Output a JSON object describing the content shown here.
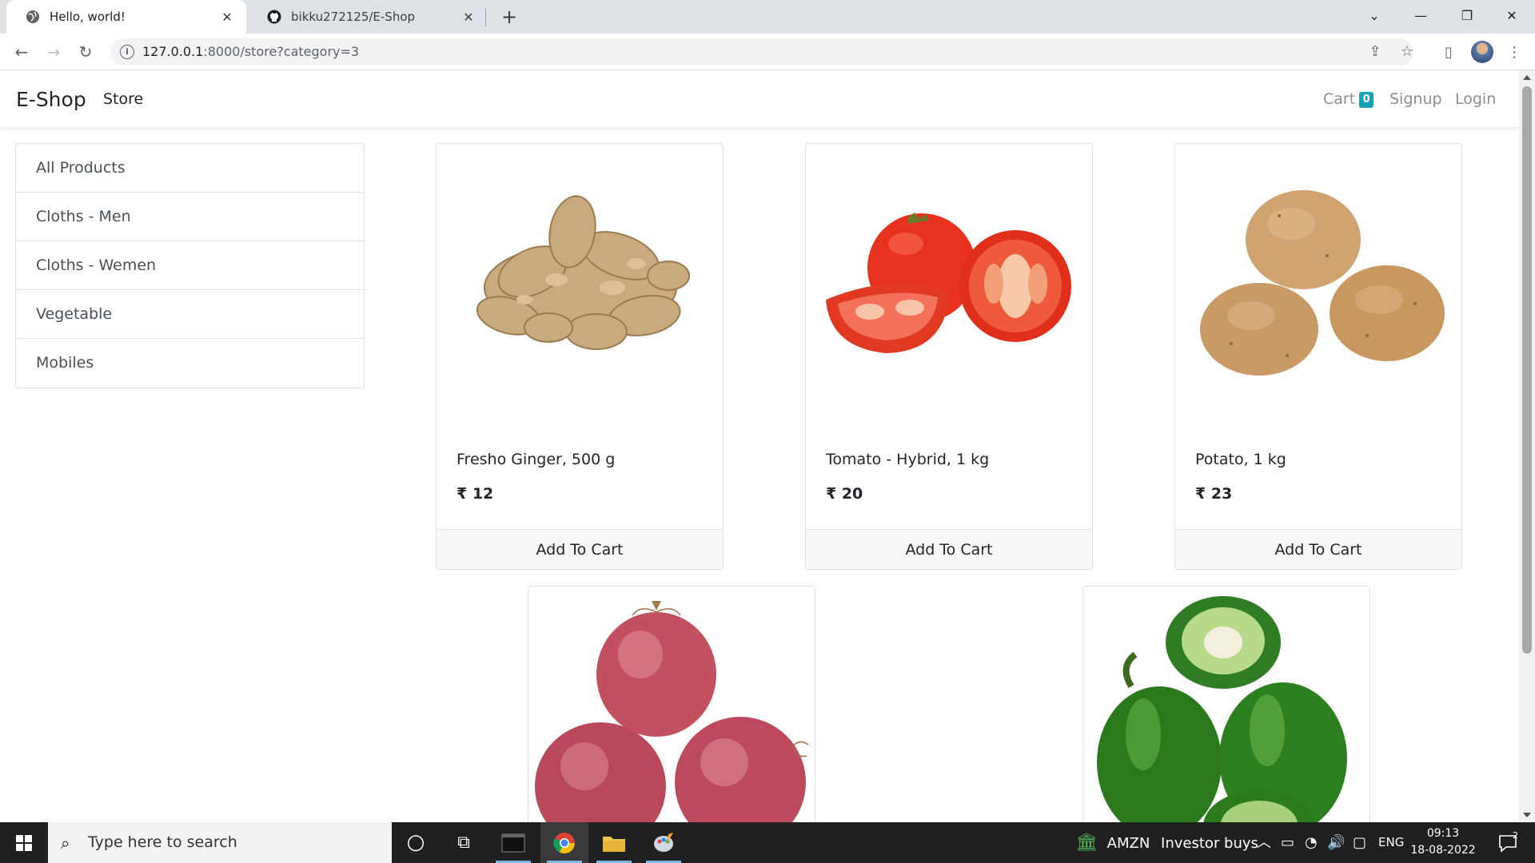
{
  "browser": {
    "tabs": [
      {
        "title": "Hello, world!"
      },
      {
        "title": "bikku272125/E-Shop"
      }
    ],
    "url_host": "127.0.0.1",
    "url_rest": ":8000/store?category=3"
  },
  "navbar": {
    "brand": "E-Shop",
    "store": "Store",
    "cart_label": "Cart",
    "cart_count": "0",
    "signup": "Signup",
    "login": "Login"
  },
  "categories": [
    "All Products",
    "Cloths - Men",
    "Cloths - Wemen",
    "Vegetable",
    "Mobiles"
  ],
  "products": [
    {
      "name": "Fresho Ginger, 500 g",
      "price": "₹ 12",
      "button": "Add To Cart",
      "image": "ginger"
    },
    {
      "name": "Tomato - Hybrid, 1 kg",
      "price": "₹ 20",
      "button": "Add To Cart",
      "image": "tomato"
    },
    {
      "name": "Potato, 1 kg",
      "price": "₹ 23",
      "button": "Add To Cart",
      "image": "potato"
    },
    {
      "image": "onion"
    },
    {
      "image": "capsicum"
    }
  ],
  "taskbar": {
    "search_placeholder": "Type here to search",
    "stock_ticker": "AMZN",
    "stock_text": "Investor buys",
    "language": "ENG",
    "time": "09:13",
    "date": "18-08-2022",
    "notifications": "2"
  }
}
